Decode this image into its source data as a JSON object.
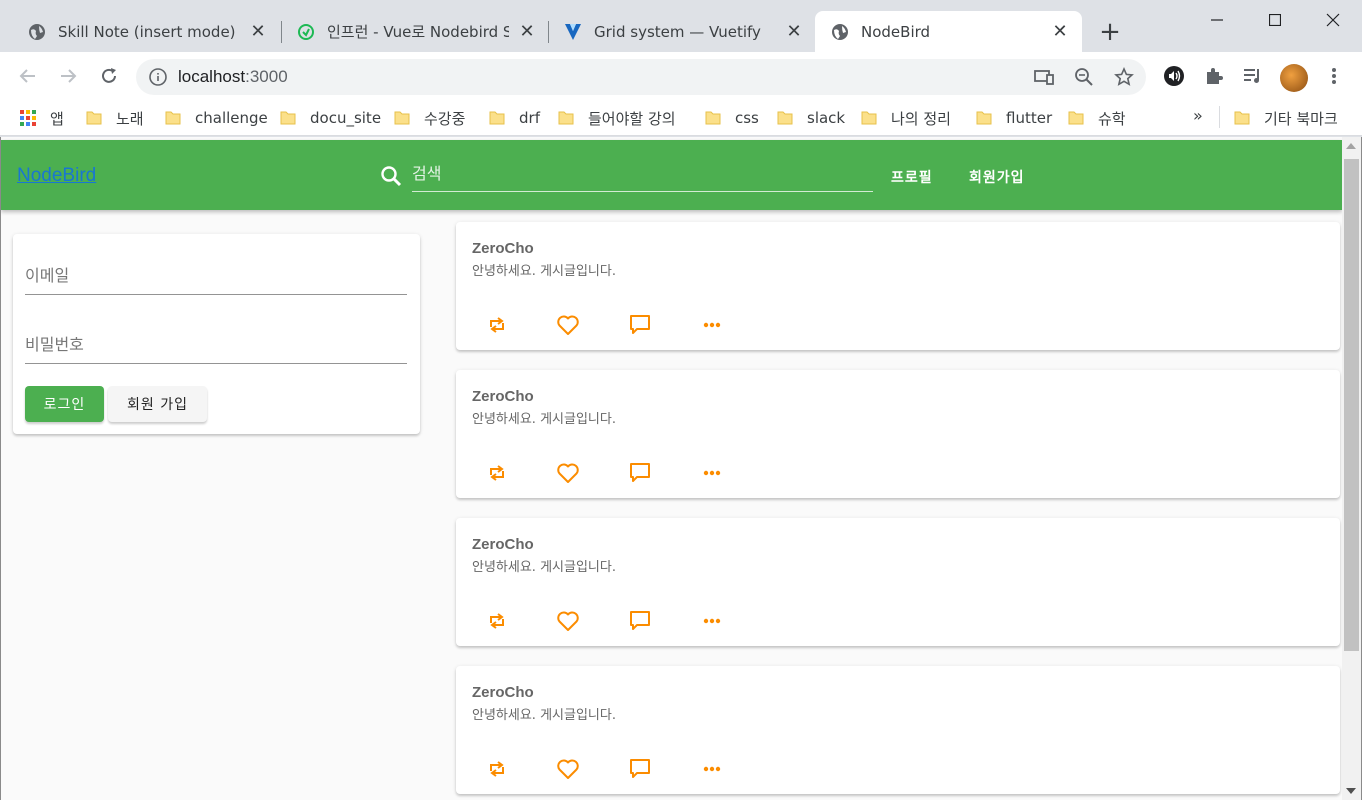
{
  "browser": {
    "tabs": [
      {
        "title": "Skill Note (insert mode)",
        "icon": "globe-icon"
      },
      {
        "title": "인프런 - Vue로 Nodebird S",
        "icon": "inflearn-icon"
      },
      {
        "title": "Grid system — Vuetify",
        "icon": "vuetify-icon"
      },
      {
        "title": "NodeBird",
        "icon": "globe-icon",
        "active": true
      }
    ],
    "url_host": "localhost",
    "url_port": ":3000",
    "bookmarks": [
      "앱",
      "노래",
      "challenge",
      "docu_site",
      "수강중",
      "drf",
      "들어야할 강의",
      "css",
      "slack",
      "나의 정리",
      "flutter",
      "슈학"
    ],
    "bookmarks_overflow": "»",
    "other_bookmarks": "기타 북마크"
  },
  "page": {
    "logo": "NodeBird",
    "search_placeholder": "검색",
    "nav": {
      "profile": "프로필",
      "signup": "회원가입"
    },
    "login_form": {
      "email_placeholder": "이메일",
      "password_placeholder": "비밀번호",
      "login_label": "로그인",
      "signup_label": "회원 가입"
    },
    "posts": [
      {
        "author": "ZeroCho",
        "content": "안녕하세요. 게시글입니다."
      },
      {
        "author": "ZeroCho",
        "content": "안녕하세요. 게시글입니다."
      },
      {
        "author": "ZeroCho",
        "content": "안녕하세요. 게시글입니다."
      },
      {
        "author": "ZeroCho",
        "content": "안녕하세요. 게시글입니다."
      }
    ]
  },
  "colors": {
    "primary": "#4caf50",
    "accent": "#fb8c00",
    "link": "#1976d2"
  }
}
